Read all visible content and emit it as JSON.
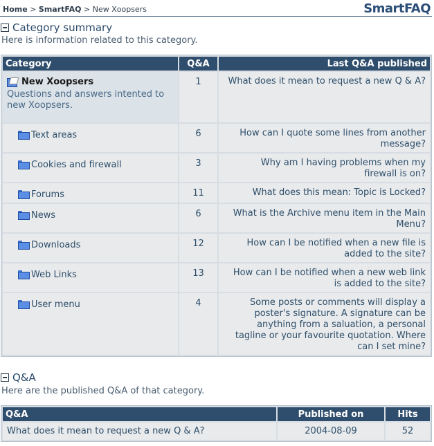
{
  "breadcrumb": {
    "home": "Home",
    "sep1": ">",
    "module": "SmartFAQ",
    "sep2": ">",
    "current": "New Xoopsers"
  },
  "brand": "SmartFAQ",
  "category_summary": {
    "title": "Category summary",
    "description": "Here is information related to this category.",
    "headers": {
      "category": "Category",
      "qa": "Q&A",
      "last": "Last Q&A published"
    },
    "main": {
      "name": "New Xoopsers",
      "description": "Questions and answers intented to new Xoopsers.",
      "count": "1",
      "last": "What does it mean to request a new Q & A?"
    },
    "subcategories": [
      {
        "name": "Text areas",
        "count": "6",
        "last": "How can I quote some lines from another message?"
      },
      {
        "name": "Cookies and firewall",
        "count": "3",
        "last": "Why am I having problems when my firewall is on?"
      },
      {
        "name": "Forums",
        "count": "11",
        "last": "What does this mean: Topic is Locked?"
      },
      {
        "name": "News",
        "count": "6",
        "last": "What is the Archive menu item in the Main Menu?"
      },
      {
        "name": "Downloads",
        "count": "12",
        "last": "How can I be notified when a new file is added to the site?"
      },
      {
        "name": "Web Links",
        "count": "13",
        "last": "How can I be notified when a new web link is added to the site?"
      },
      {
        "name": "User menu",
        "count": "4",
        "last": "Some posts or comments will display a poster's signature. A signature can be anything from a saluation, a personal tagline or your favourite quotation. Where can I set mine?"
      }
    ]
  },
  "qa_section": {
    "title": "Q&A",
    "description": "Here are the published Q&A of that category.",
    "headers": {
      "qa": "Q&A",
      "published": "Published on",
      "hits": "Hits"
    },
    "rows": [
      {
        "question": "What does it mean to request a new Q & A?",
        "published": "2004-08-09",
        "hits": "52"
      }
    ]
  }
}
